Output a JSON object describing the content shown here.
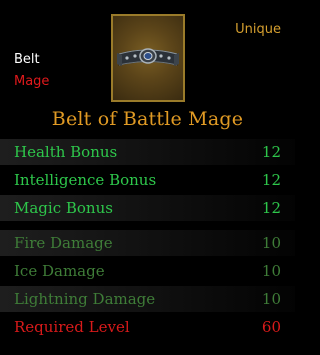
{
  "item": {
    "type": "Belt",
    "class": "Mage",
    "rarity": "Unique",
    "name": "Belt of Battle Mage",
    "icon": "belt-icon"
  },
  "stats": [
    {
      "label": "Health Bonus",
      "value": "12"
    },
    {
      "label": "Intelligence Bonus",
      "value": "12"
    },
    {
      "label": "Magic Bonus",
      "value": "12"
    },
    {
      "label": "Fire Damage",
      "value": "10"
    },
    {
      "label": "Ice Damage",
      "value": "10"
    },
    {
      "label": "Lightning Damage",
      "value": "10"
    }
  ],
  "requirement": {
    "label": "Required Level",
    "value": "60"
  },
  "colors": {
    "name": "#e09a24",
    "rarity": "#d59f2f",
    "bonus": "#2ec74b",
    "damage": "#3f7d38",
    "requirement": "#d81a1a",
    "class": "#e0191c"
  }
}
